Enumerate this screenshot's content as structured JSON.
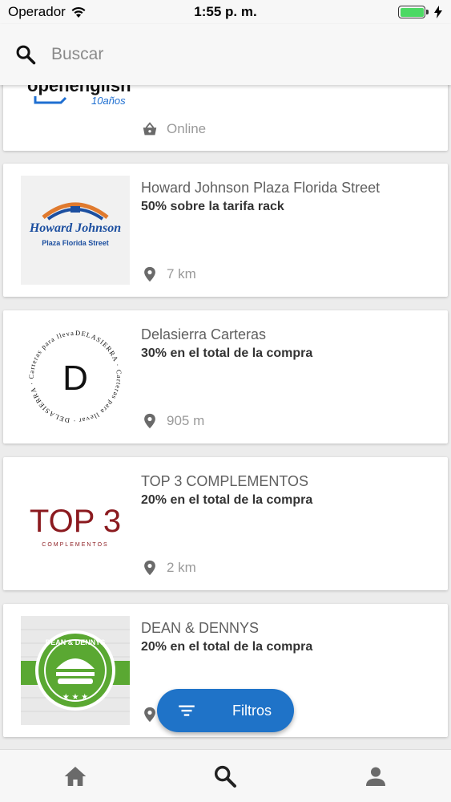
{
  "status_bar": {
    "carrier": "Operador",
    "time": "1:55 p. m."
  },
  "search": {
    "placeholder": "Buscar"
  },
  "partial_card": {
    "logo_text": "openenglish",
    "logo_badge": "10años",
    "meta": "Online",
    "meta_icon": "basket-icon"
  },
  "cards": [
    {
      "name": "Howard Johnson Plaza Florida Street",
      "offer": "50% sobre la tarifa rack",
      "distance": "7 km",
      "logo_line1": "Howard Johnson",
      "logo_line2": "Plaza Florida Street"
    },
    {
      "name": "Delasierra Carteras",
      "offer": "30% en el total de la compra",
      "distance": "905 m",
      "logo_ring": "DELASIERRA · Carteras para llevar · DELASIERRA · Carteras para llevar ·",
      "logo_letter": "D"
    },
    {
      "name": "TOP 3 COMPLEMENTOS",
      "offer": "20% en el total de la compra",
      "distance": "2 km",
      "logo_main": "TOP 3",
      "logo_sub": "COMPLEMENTOS"
    },
    {
      "name": "DEAN & DENNYS",
      "offer": "20% en el total de la compra",
      "distance": "",
      "logo_ribbon": "DEAN & DENNYS"
    }
  ],
  "fab": {
    "label": "Filtros"
  },
  "colors": {
    "accent": "#1f73c8",
    "top3_red": "#8b1a1f",
    "dean_green": "#5aa832"
  }
}
